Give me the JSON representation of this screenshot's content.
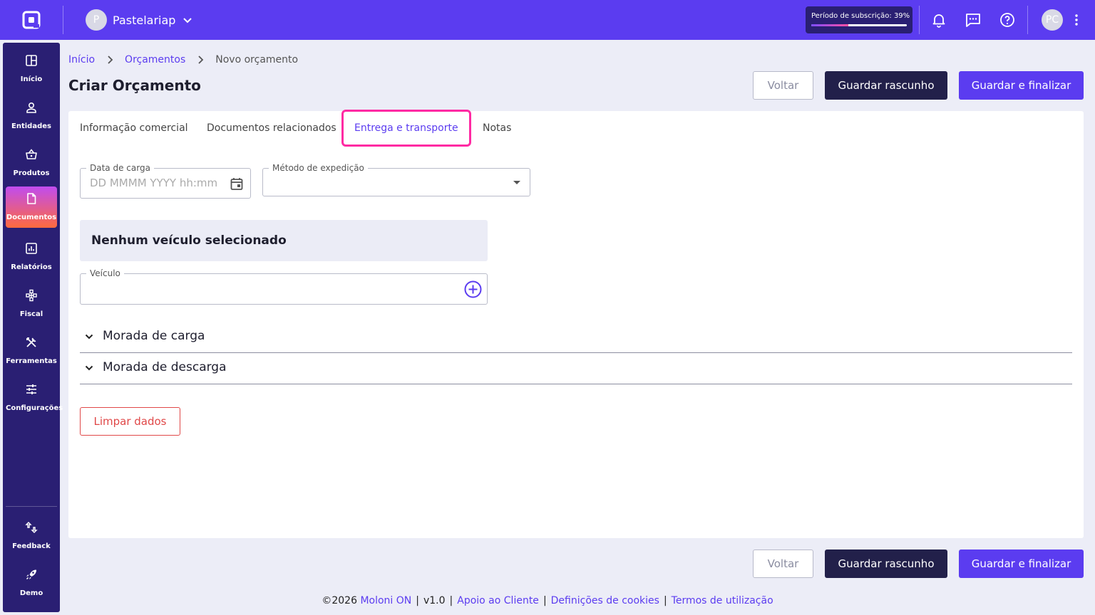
{
  "topbar": {
    "company_initial": "P",
    "company_name": "Pastelariap",
    "subscription_label": "Período de subscrição: 39%",
    "subscription_progress": 0.39,
    "user_initials": "PC"
  },
  "sidebar": {
    "items": [
      {
        "label": "Início",
        "icon": "dashboard-icon"
      },
      {
        "label": "Entidades",
        "icon": "person-icon"
      },
      {
        "label": "Produtos",
        "icon": "basket-icon"
      },
      {
        "label": "Documentos",
        "icon": "document-icon",
        "active": true
      },
      {
        "label": "Relatórios",
        "icon": "chart-icon"
      },
      {
        "label": "Fiscal",
        "icon": "network-icon"
      },
      {
        "label": "Ferramentas",
        "icon": "tools-icon"
      },
      {
        "label": "Configurações",
        "icon": "sliders-icon"
      }
    ],
    "bottom_items": [
      {
        "label": "Feedback",
        "icon": "feedback-icon"
      },
      {
        "label": "Demo",
        "icon": "rocket-icon"
      }
    ]
  },
  "breadcrumb": {
    "home": "Início",
    "section": "Orçamentos",
    "current": "Novo orçamento"
  },
  "page": {
    "title": "Criar Orçamento"
  },
  "actions": {
    "back": "Voltar",
    "save_draft": "Guardar rascunho",
    "save_finalize": "Guardar e finalizar"
  },
  "tabs": [
    {
      "label": "Informação comercial"
    },
    {
      "label": "Documentos relacionados"
    },
    {
      "label": "Entrega e transporte",
      "active": true
    },
    {
      "label": "Notas"
    }
  ],
  "form": {
    "load_date_label": "Data de carga",
    "load_date_placeholder": "DD MMMM YYYY hh:mm",
    "shipping_method_label": "Método de expedição",
    "shipping_method_value": "",
    "no_vehicle": "Nenhum veículo selecionado",
    "vehicle_label": "Veículo",
    "vehicle_value": "",
    "load_address": "Morada de carga",
    "unload_address": "Morada de descarga",
    "clear": "Limpar dados"
  },
  "footer": {
    "copyright": "©2026",
    "brand": "Moloni ON",
    "version": "v1.0",
    "support": "Apoio ao Cliente",
    "cookies": "Definições de cookies",
    "terms": "Termos de utilização"
  },
  "colors": {
    "brand": "#5b3cf0",
    "sidebar": "#2a1f73",
    "dark_button": "#22204a",
    "active_tab_highlight": "#ff2aa3",
    "danger": "#e04848"
  }
}
